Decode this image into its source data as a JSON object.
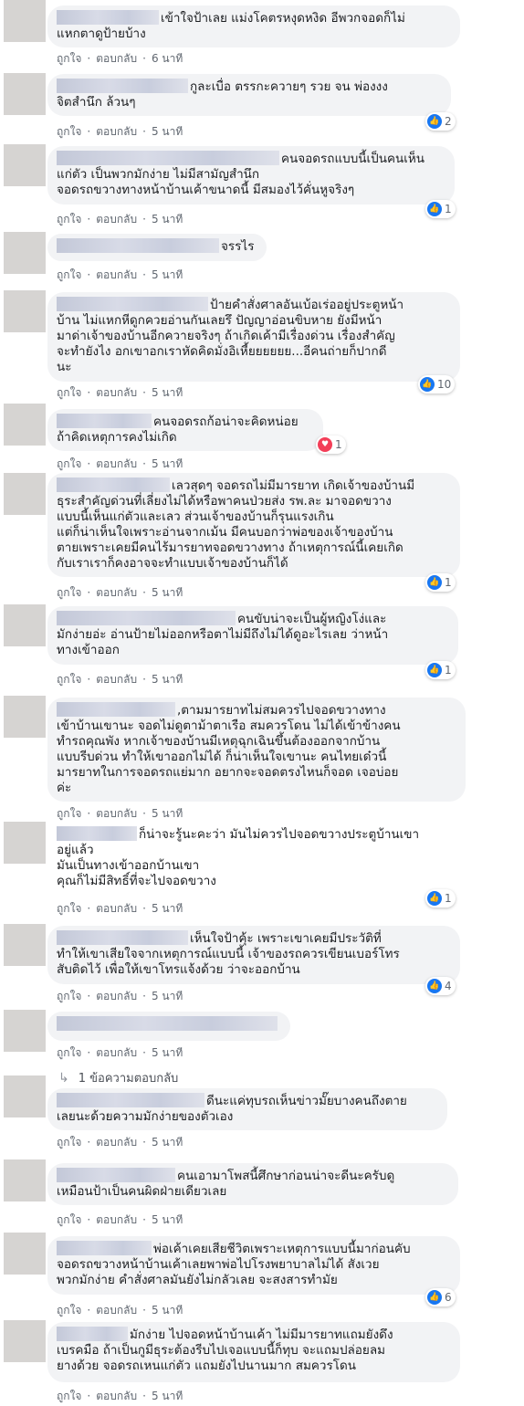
{
  "labels": {
    "like": "ถูกใจ",
    "reply": "ตอบกลับ",
    "dot": "·"
  },
  "colors": {
    "accent": "#1877f2",
    "love": "#f33e58",
    "bubble": "#f2f3f5",
    "meta": "#606770"
  },
  "comments": [
    {
      "text": "เข้าใจป้าเลย แม่งโคตรหงุดหงิด อีพวกจอดก็ไม่\nแหกตาดูป้ายบ้าง",
      "time": "6 นาที"
    },
    {
      "text": "กูละเบื่อ ตรรกะควายๆ รวย จน พ่องงง\nจิตสำนึก ล้วนๆ",
      "time": "5 นาที",
      "reaction": {
        "type": "like",
        "count": "2",
        "icon": "thumbs-up-icon"
      }
    },
    {
      "text": "คนจอดรถแบบนี้เป็นคนเห็น\nแก่ตัว เป็นพวกมักง่าย ไม่มีสามัญสำนึก\nจอดรถขวางทางหน้าบ้านเค้าขนาดนี้ มีสมองไว้คั่นหูจริงๆ",
      "time": "5 นาที",
      "reaction": {
        "type": "like",
        "count": "1",
        "icon": "thumbs-up-icon"
      }
    },
    {
      "text": "จรรไร",
      "time": "5 นาที"
    },
    {
      "text": "ป้ายคำสั่งศาลอันเบ้อเร่ออยู่ประตูหน้า\nบ้าน ไม่แหกหีดูกควยอ่านกันเลยรึ ปัญญาอ่อนขิบหาย ยังมีหน้า\nมาด่าเจ้าของบ้านอีกควายจริงๆ ถ้าเกิดเค้ามีเรื่องด่วน เรื่องสำคัญ\nจะทำยังไง อกเขาอกเราหัดคิดมั่งอิเหี้ยยยยยย...อีคนถ่ายก็ปากดี\nนะ",
      "time": "5 นาที",
      "reaction": {
        "type": "like",
        "count": "10",
        "icon": "thumbs-up-icon"
      }
    },
    {
      "text": "คนจอดรถก้อน่าจะคิดหน่อย\nถ้าคิดเหตุการคงไม่เกิด",
      "time": "5 นาที",
      "reaction": {
        "type": "love",
        "count": "1",
        "icon": "heart-icon"
      }
    },
    {
      "text": "เลวสุดๆ จอดรถไม่มีมารยาท เกิดเจ้าของบ้านมี\nธุระสำคัญด่วนที่เลี่ยงไม่ได้หรือพาคนป่วยส่ง รพ.ละ มาจอดขวาง\nแบบนี้เห็นแก่ตัวและเลว ส่วนเจ้าของบ้านก็รุนแรงเกิน\nแต่ก็น่าเห็นใจเพราะอ่านจากเม้น มีคนบอกว่าพ่อของเจ้าของบ้าน\nตายเพราะเคยมีคนไร้มารยาทจอดขวางทาง ถ้าเหตุการณ์นี้เคยเกิด\nกับเราเราก็คงอาจจะทำแบบเจ้าของบ้านก็ได้",
      "time": "5 นาที",
      "reaction": {
        "type": "like",
        "count": "1",
        "icon": "thumbs-up-icon"
      }
    },
    {
      "text": "คนขับน่าจะเป็นผู้หญิงโง่และ\nมักง่ายอ่ะ อ่านป้ายไม่ออกหรือตาไม่มีถึงไม่ได้ดูอะไรเลย ว่าหน้า\nทางเข้าออก",
      "time": "5 นาที",
      "reaction": {
        "type": "like",
        "count": "1",
        "icon": "thumbs-up-icon"
      }
    },
    {
      "text": ",ตามมารยาทไม่สมควรไปจอดขวางทาง\nเข้าบ้านเขานะ จอดไม่ดูตาม้าตาเรือ สมควรโดน ไม่ได้เข้าข้างคน\nทำรถคุณพัง หากเจ้าของบ้านมีเหตุฉุกเฉินขึ้นต้องออกจากบ้าน\nแบบรีบด่วน ทำให้เขาออกไม่ได้ ก็น่าเห็นใจเขานะ คนไทยเด๋วนี้\nมารยาทในการจอดรถแย่มาก อยากจะจอดตรงไหนก็จอด เจอบ่อย\nค่ะ",
      "time": "5 นาที"
    },
    {
      "text": "ก็น่าจะรู้นะคะว่า มันไม่ควรไปจอดขวางประตูบ้านเขา\nอยู่แล้ว\nมันเป็นทางเข้าออกบ้านเขา\nคุณก็ไม่มีสิทธิ์ที่จะไปจอดขวาง",
      "time": "5 นาที",
      "reaction": {
        "type": "like",
        "count": "1",
        "icon": "thumbs-up-icon"
      }
    },
    {
      "text": "เห็นใจป้าคุ้ะ เพราะเขาเคยมีประวัติที่\nทำให้เขาเสียใจจากเหตุการณ์แบบนี้ เจ้าของรถควรเขียนเบอร์โทร\nสับติดไว้ เพื่อให้เขาโทรแจ้งด้วย ว่าจะออกบ้าน",
      "time": "5 นาที",
      "reaction": {
        "type": "like",
        "count": "4",
        "icon": "thumbs-up-icon"
      }
    },
    {
      "text": "",
      "time": "5 นาที",
      "replies_label": "1 ข้อความตอบกลับ"
    },
    {
      "text": "ดีนะแค่ทุบรถเห็นข่าวมั๊ยบางคนถึงตาย\nเลยนะด้วยความมักง่ายของตัวเอง",
      "time": "5 นาที"
    },
    {
      "text": "คนเอามาโพสนี้ศึกษาก่อนน่าจะดีนะครับดู\nเหมือนป้าเป็นคนผิดฝ่ายเดียวเลย",
      "time": "5 นาที"
    },
    {
      "text": "พ่อเค้าเคยเสียชีวิตเพราะเหตุการแบบนี้มาก่อนคับ\nจอดรถขวางหน้าบ้านเค้าเลยพาพ่อไปโรงพยาบาลไม่ได้ สังเวย\nพวกมักง่าย คำสั่งศาลมันยังไม่กลัวเลย จะสงสารทำมัย",
      "time": "5 นาที",
      "reaction": {
        "type": "like",
        "count": "6",
        "icon": "thumbs-up-icon"
      }
    },
    {
      "text": "มักง่าย ไปจอดหน้าบ้านเค้า ไม่มีมารยาทแถมยังดึง\nเบรคมือ ถ้าเป็นกูมีธุระต้องรีบไปเจอแบบนี้ก็ทุบ จะแถมปล่อยลม\nยางด้วย จอดรถเหนแก่ตัว แถมยังไปนานมาก สมควรโดน",
      "time": "5 นาที"
    }
  ]
}
